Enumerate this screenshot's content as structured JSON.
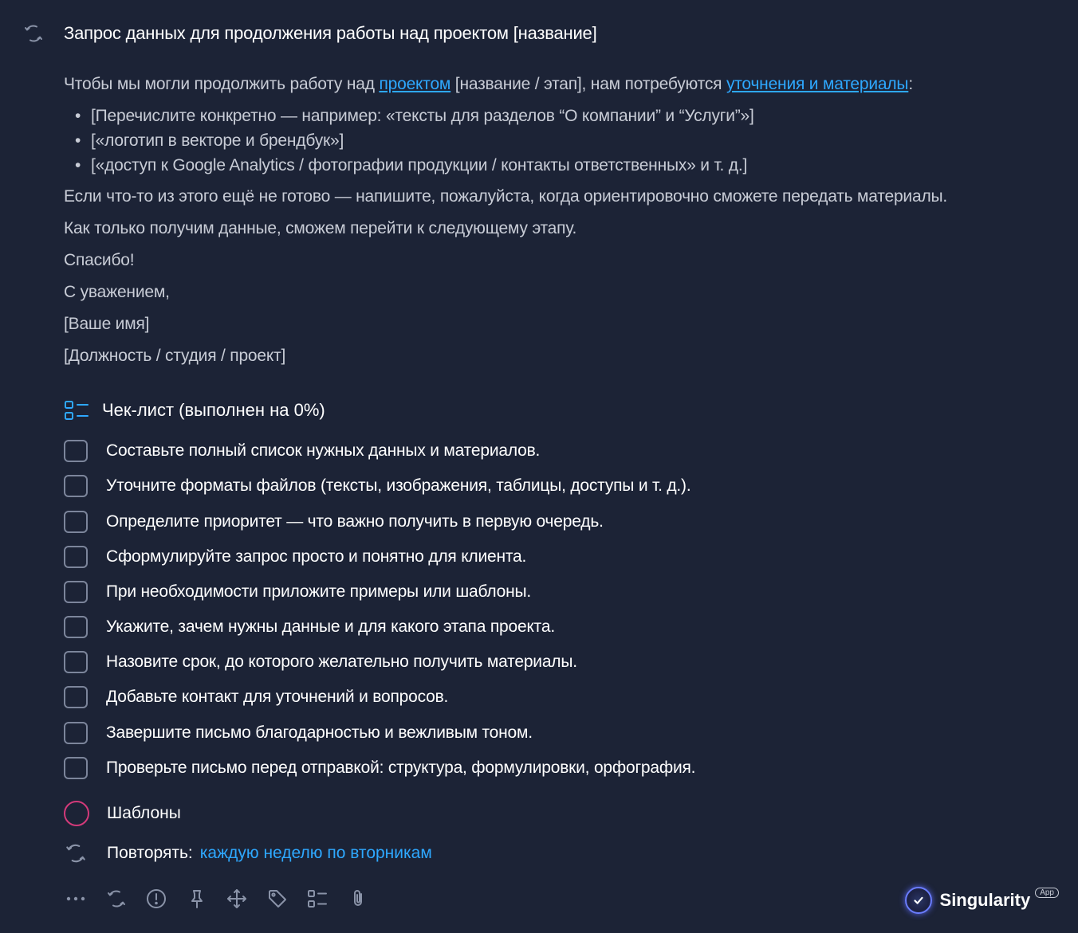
{
  "title": "Запрос данных для продолжения работы над проектом [название]",
  "body": {
    "intro_before": "Чтобы мы могли продолжить работу над ",
    "intro_link1": "проектом",
    "intro_mid": " [название / этап], нам потребуются ",
    "intro_link2": "уточнения и материалы",
    "intro_after": ":",
    "bullets": [
      "[Перечислите конкретно — например: «тексты для разделов “О компании” и “Услуги”»]",
      "[«логотип в векторе и брендбук»]",
      "[«доступ к Google Analytics / фотографии продукции / контакты ответственных» и т. д.]"
    ],
    "line_not_ready": "Если что-то из этого ещё не готово — напишите, пожалуйста, когда ориентировочно сможете передать материалы.",
    "line_next_step": " Как только получим данные, сможем перейти к следующему этапу.",
    "line_thanks": "Спасибо!",
    "line_regards": " С уважением,",
    "line_name": " [Ваше имя]",
    "line_position": " [Должность / студия / проект]"
  },
  "checklist": {
    "header": "Чек-лист (выполнен на 0%)",
    "progress_percent": 0,
    "items": [
      "Составьте полный список нужных данных и материалов.",
      "Уточните форматы файлов (тексты, изображения, таблицы, доступы и т. д.).",
      "Определите приоритет — что важно получить в первую очередь.",
      "Сформулируйте запрос просто и понятно для клиента.",
      "При необходимости приложите примеры или шаблоны.",
      "Укажите, зачем нужны данные и для какого этапа проекта.",
      "Назовите срок, до которого желательно получить материалы.",
      "Добавьте контакт для уточнений и вопросов.",
      "Завершите письмо благодарностью и вежливым тоном.",
      "Проверьте письмо перед отправкой: структура, формулировки, орфография."
    ]
  },
  "templates_label": "Шаблоны",
  "repeat": {
    "label": "Повторять:",
    "value": "каждую неделю по вторникам"
  },
  "toolbar_icons": [
    "more-icon",
    "repeat-icon",
    "priority-icon",
    "pin-icon",
    "move-icon",
    "tag-icon",
    "checklist-icon",
    "attachment-icon"
  ],
  "brand": {
    "name": "Singularity",
    "badge": "App"
  },
  "colors": {
    "background": "#1c2336",
    "link": "#2ea8ff",
    "templates_ring": "#d33a7a"
  }
}
